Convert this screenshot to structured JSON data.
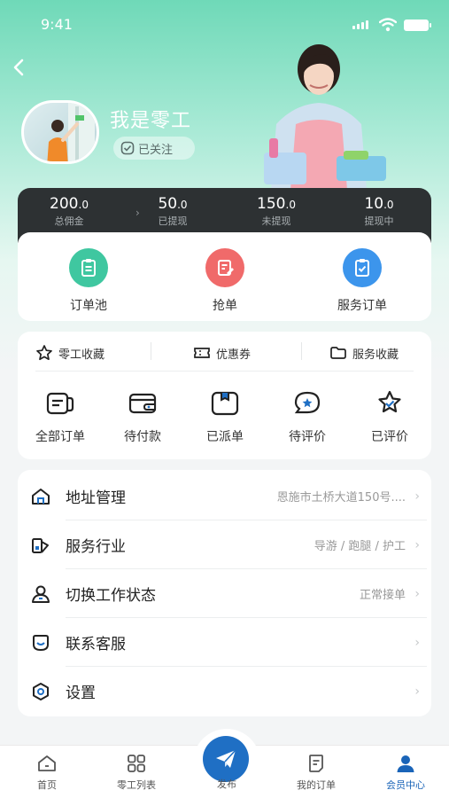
{
  "status_bar": {
    "time": "9:41"
  },
  "profile": {
    "name": "我是零工",
    "follow_label": "已关注"
  },
  "stats": [
    {
      "value_int": "200",
      "value_dec": ".0",
      "label": "总佣金"
    },
    {
      "value_int": "50",
      "value_dec": ".0",
      "label": "已提现"
    },
    {
      "value_int": "150",
      "value_dec": ".0",
      "label": "未提现"
    },
    {
      "value_int": "10",
      "value_dec": ".0",
      "label": "提现中"
    }
  ],
  "quick_actions": [
    {
      "label": "订单池",
      "icon": "clipboard-icon",
      "color": "#3fc7a0"
    },
    {
      "label": "抢单",
      "icon": "grab-order-icon",
      "color": "#f06a6a"
    },
    {
      "label": "服务订单",
      "icon": "service-order-icon",
      "color": "#3c95ec"
    }
  ],
  "favorites": [
    {
      "label": "零工收藏",
      "icon": "star-icon"
    },
    {
      "label": "优惠券",
      "icon": "coupon-icon"
    },
    {
      "label": "服务收藏",
      "icon": "folder-icon"
    }
  ],
  "orders": [
    {
      "label": "全部订单",
      "icon": "all-orders-icon"
    },
    {
      "label": "待付款",
      "icon": "wallet-icon"
    },
    {
      "label": "已派单",
      "icon": "dispatched-icon"
    },
    {
      "label": "待评价",
      "icon": "pending-review-icon"
    },
    {
      "label": "已评价",
      "icon": "reviewed-icon"
    }
  ],
  "menu": [
    {
      "label": "地址管理",
      "value": "恩施市土桥大道150号....",
      "icon": "home-icon"
    },
    {
      "label": "服务行业",
      "value": "导游 / 跑腿 / 护工",
      "icon": "industry-icon"
    },
    {
      "label": "切换工作状态",
      "value": "正常接单",
      "icon": "user-status-icon"
    },
    {
      "label": "联系客服",
      "value": "",
      "icon": "customer-service-icon"
    },
    {
      "label": "设置",
      "value": "",
      "icon": "settings-icon"
    }
  ],
  "tabs": [
    {
      "label": "首页",
      "icon": "home-tab-icon"
    },
    {
      "label": "零工列表",
      "icon": "grid-icon"
    },
    {
      "label": "发布",
      "icon": "paper-plane-icon"
    },
    {
      "label": "我的订单",
      "icon": "order-doc-icon"
    },
    {
      "label": "会员中心",
      "icon": "member-icon",
      "active": true
    }
  ]
}
